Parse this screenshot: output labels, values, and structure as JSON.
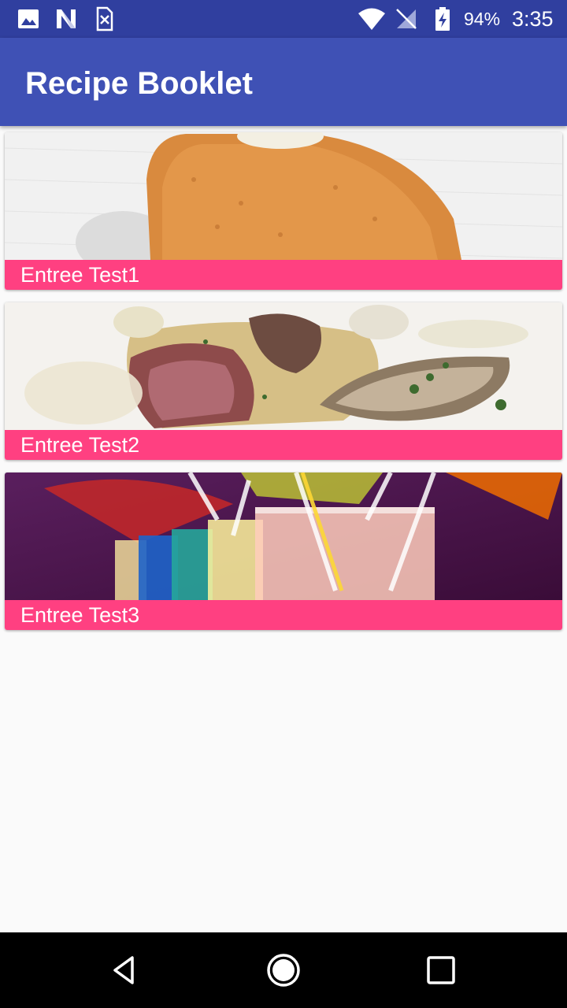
{
  "status_bar": {
    "battery_percent": "94%",
    "time": "3:35",
    "left_icons": [
      "image-notification-icon",
      "n-app-notification-icon",
      "sim-error-icon"
    ],
    "right_icons": [
      "wifi-icon",
      "no-signal-icon",
      "battery-charging-icon"
    ]
  },
  "app_bar": {
    "title": "Recipe Booklet",
    "color": "#3f51b5"
  },
  "recipes": [
    {
      "label": "Entree Test1",
      "image": "fried-croquette-photo"
    },
    {
      "label": "Entree Test2",
      "image": "roast-meat-plate-photo"
    },
    {
      "label": "Entree Test3",
      "image": "colorful-drinks-photo"
    }
  ],
  "theme": {
    "status_bar_color": "#303f9f",
    "accent": "#ff4081",
    "background": "#fafafa"
  },
  "nav_bar": {
    "buttons": [
      "back-icon",
      "home-icon",
      "recents-icon"
    ]
  }
}
